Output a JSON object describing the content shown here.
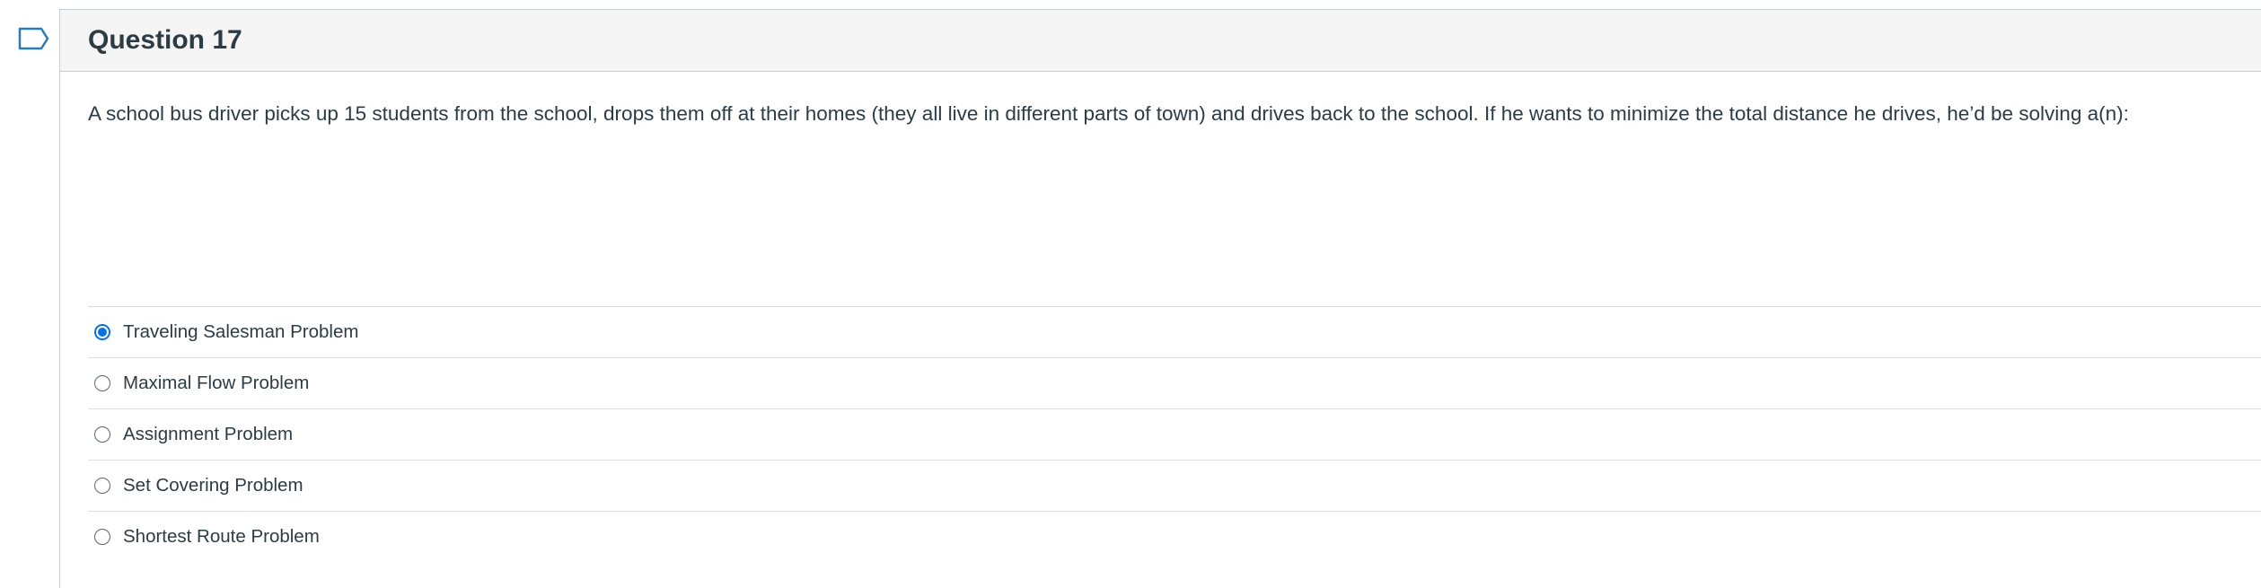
{
  "question": {
    "title": "Question 17",
    "text": "A school bus driver picks up 15 students from the school, drops them off at their homes (they all live in different parts of town) and drives back to the school. If he wants to minimize the total distance he drives, he’d be solving a(n):"
  },
  "answers": [
    {
      "label": "Traveling Salesman Problem",
      "selected": true
    },
    {
      "label": "Maximal Flow Problem",
      "selected": false
    },
    {
      "label": "Assignment Problem",
      "selected": false
    },
    {
      "label": "Set Covering Problem",
      "selected": false
    },
    {
      "label": "Shortest Route Problem",
      "selected": false
    }
  ],
  "colors": {
    "accent": "#0770e3",
    "flag": "#2a7abf",
    "header_bg": "#f5f5f5"
  },
  "icons": {
    "flag": "bookmark-flag-icon"
  }
}
